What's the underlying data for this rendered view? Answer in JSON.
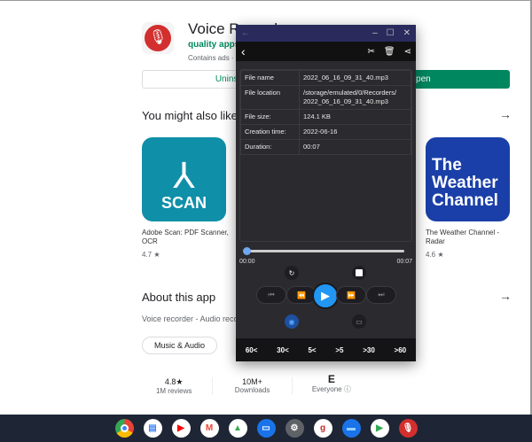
{
  "app": {
    "title": "Voice Recorder",
    "developer": "quality apps",
    "ads": "Contains ads ·",
    "uninstall": "Uninstall",
    "open": "Open"
  },
  "similar": {
    "heading": "You might also like",
    "cards": [
      {
        "name": "Adobe Scan: PDF Scanner, OCR",
        "rating": "4.7 ★",
        "icon_text": "SCAN",
        "color": "#0f8fa8"
      },
      {
        "name": "The Weather Channel - Radar",
        "rating": "4.6 ★",
        "icon_text": "The Weather Channel",
        "color": "#1a3fa8"
      }
    ]
  },
  "about": {
    "heading": "About this app",
    "desc": "Voice recorder - Audio recorder",
    "chip": "Music & Audio"
  },
  "stats": [
    {
      "value": "4.8★",
      "label": "1M reviews"
    },
    {
      "value": "10M+",
      "label": "Downloads"
    },
    {
      "value": "E",
      "label": "Everyone ⓘ"
    }
  ],
  "dialog": {
    "info": [
      {
        "label": "File name",
        "value": "2022_06_16_09_31_40.mp3"
      },
      {
        "label": "File location",
        "value": "/storage/emulated/0/Recorders/ 2022_06_16_09_31_40.mp3"
      },
      {
        "label": "File size:",
        "value": "124.1 KB"
      },
      {
        "label": "Creation time:",
        "value": "2022-06-16"
      },
      {
        "label": "Duration:",
        "value": "00:07"
      }
    ],
    "time_start": "00:00",
    "time_end": "00:07",
    "progress": 0,
    "skip": [
      "60<",
      "30<",
      "5<",
      ">5",
      ">30",
      ">60"
    ],
    "accent": "#2196f3"
  },
  "taskbar": [
    "chrome",
    "docs",
    "youtube",
    "gmail",
    "drive",
    "messages",
    "settings",
    "g-app",
    "files",
    "play-store",
    "voice-recorder"
  ]
}
